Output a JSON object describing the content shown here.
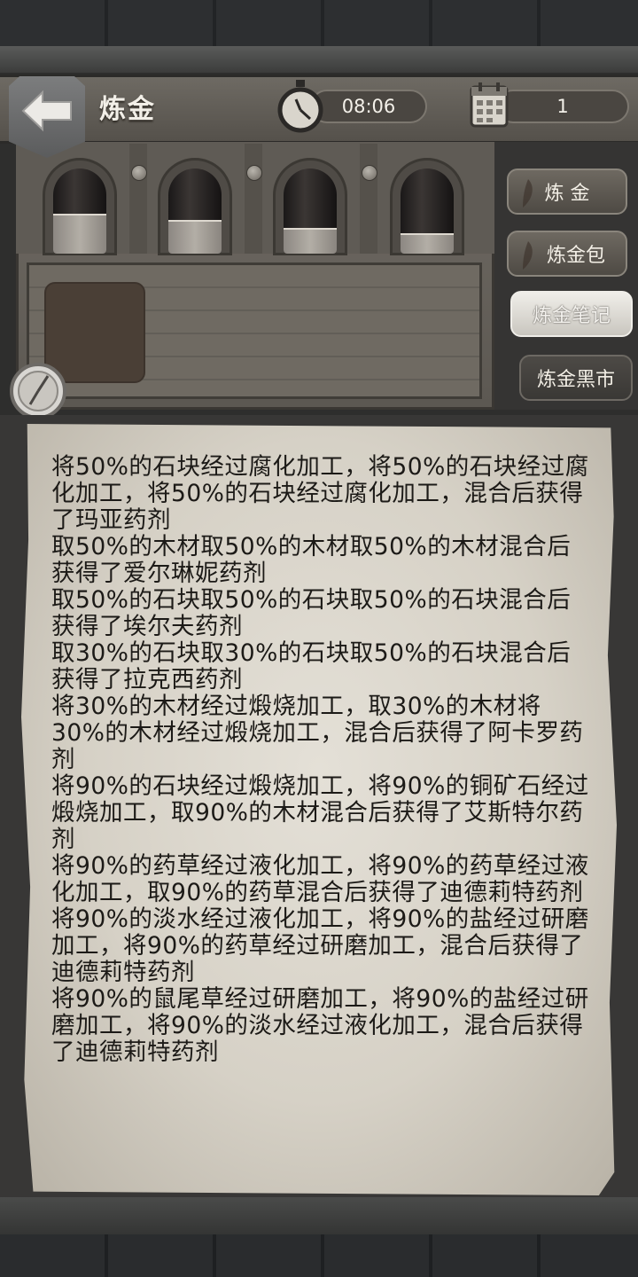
{
  "header": {
    "title": "炼金",
    "time": "08:06",
    "day": "1"
  },
  "vials": [
    {
      "level": 0.45
    },
    {
      "level": 0.38
    },
    {
      "level": 0.28
    },
    {
      "level": 0.22
    }
  ],
  "side_menu": {
    "items": [
      {
        "label": "炼 金"
      },
      {
        "label": "炼金包"
      },
      {
        "label": "炼金笔记"
      },
      {
        "label": "炼金黑市"
      }
    ],
    "active": "炼金笔记"
  },
  "notes": [
    "将50%的石块经过腐化加工，将50%的石块经过腐化加工，将50%的石块经过腐化加工，混合后获得了玛亚药剂",
    "取50%的木材取50%的木材取50%的木材混合后获得了爱尔琳妮药剂",
    "取50%的石块取50%的石块取50%的石块混合后获得了埃尔夫药剂",
    "取30%的石块取30%的石块取50%的石块混合后获得了拉克西药剂",
    "将30%的木材经过煅烧加工，取30%的木材将30%的木材经过煅烧加工，混合后获得了阿卡罗药剂",
    "将90%的石块经过煅烧加工，将90%的铜矿石经过煅烧加工，取90%的木材混合后获得了艾斯特尔药剂",
    "将90%的药草经过液化加工，将90%的药草经过液化加工，取90%的药草混合后获得了迪德莉特药剂",
    "将90%的淡水经过液化加工，将90%的盐经过研磨加工，将90%的药草经过研磨加工，混合后获得了迪德莉特药剂",
    "将90%的鼠尾草经过研磨加工，将90%的盐经过研磨加工，将90%的淡水经过液化加工，混合后获得了迪德莉特药剂"
  ]
}
